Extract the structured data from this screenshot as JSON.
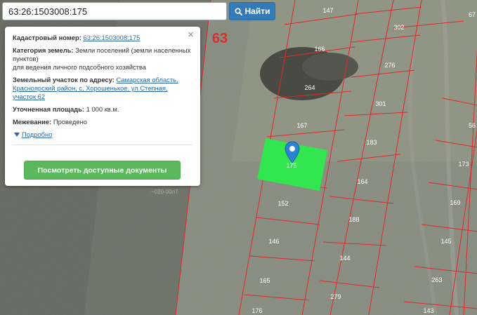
{
  "search": {
    "value": "63:26:1503008:175",
    "button_label": "Найти"
  },
  "map": {
    "region_label": "63",
    "faint_label": "~020-00л7",
    "selected_parcel_label": "175",
    "selected_color": "#32e650",
    "boundary_color": "#e0282d",
    "parcels": [
      "147",
      "302",
      "166",
      "276",
      "264",
      "301",
      "67",
      "167",
      "183",
      "56",
      "173",
      "164",
      "169",
      "152",
      "188",
      "146",
      "145",
      "144",
      "165",
      "263",
      "176",
      "279",
      "143"
    ]
  },
  "popup": {
    "close_label": "×",
    "cadastral_label": "Кадастровый номер:",
    "cadastral_value": "63:26:1503008:175",
    "category_label": "Категория земель:",
    "category_value": "Земли поселений (земли населенных пунктов)",
    "purpose": "для ведения личного подсобного хозяйства",
    "address_label": "Земельный участок по адресу:",
    "address_link": "Самарская область, Красноярский район, с. Хорошенькое, ул.Степная, участок 62",
    "area_label": "Уточненная площадь:",
    "area_value": "1 000 кв.м.",
    "survey_label": "Межевание:",
    "survey_value": "Проведено",
    "details_label": "Подробно",
    "docs_button": "Посмотреть доступные документы"
  }
}
